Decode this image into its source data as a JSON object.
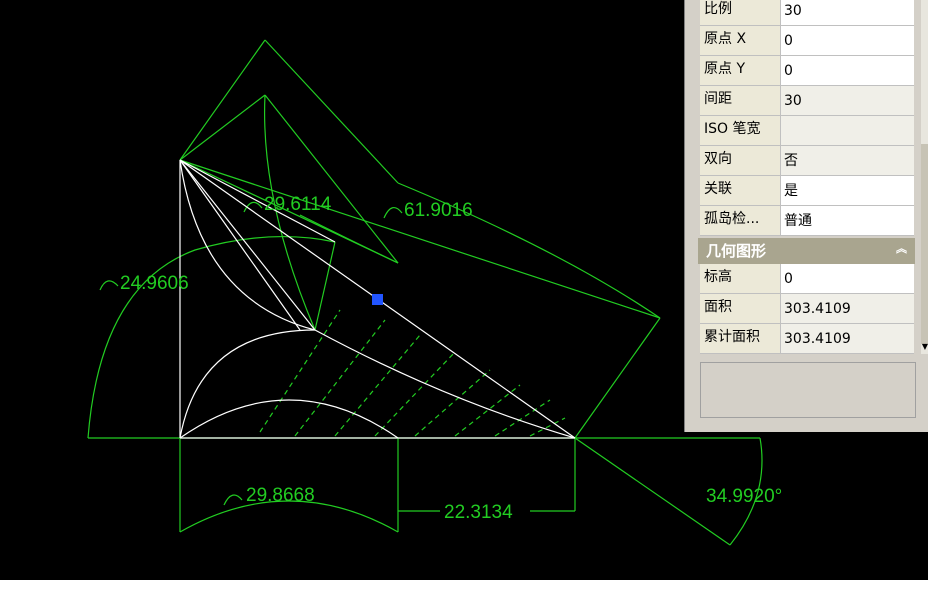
{
  "drawing": {
    "dimensions": {
      "arc_top": "29.6114",
      "arc_big": "61.9016",
      "arc_left": "24.9606",
      "arc_bottom": "29.8668",
      "linear": "22.3134",
      "angle": "34.9920°"
    },
    "colors": {
      "background": "#000000",
      "dimension": "#22cc22",
      "geometry": "#ffffff",
      "grip": "#2255ff"
    }
  },
  "properties": {
    "hatch_rows": [
      {
        "label": "比例",
        "value": "30"
      },
      {
        "label": "原点 X",
        "value": "0"
      },
      {
        "label": "原点 Y",
        "value": "0"
      },
      {
        "label": "间距",
        "value": "30"
      },
      {
        "label": "ISO 笔宽",
        "value": ""
      },
      {
        "label": "双向",
        "value": "否"
      },
      {
        "label": "关联",
        "value": "是"
      },
      {
        "label": "孤岛检...",
        "value": "普通"
      }
    ],
    "geometry_title": "几何图形",
    "geometry_rows": [
      {
        "label": "标高",
        "value": "0"
      },
      {
        "label": "面积",
        "value": "303.4109"
      },
      {
        "label": "累计面积",
        "value": "303.4109"
      }
    ]
  }
}
